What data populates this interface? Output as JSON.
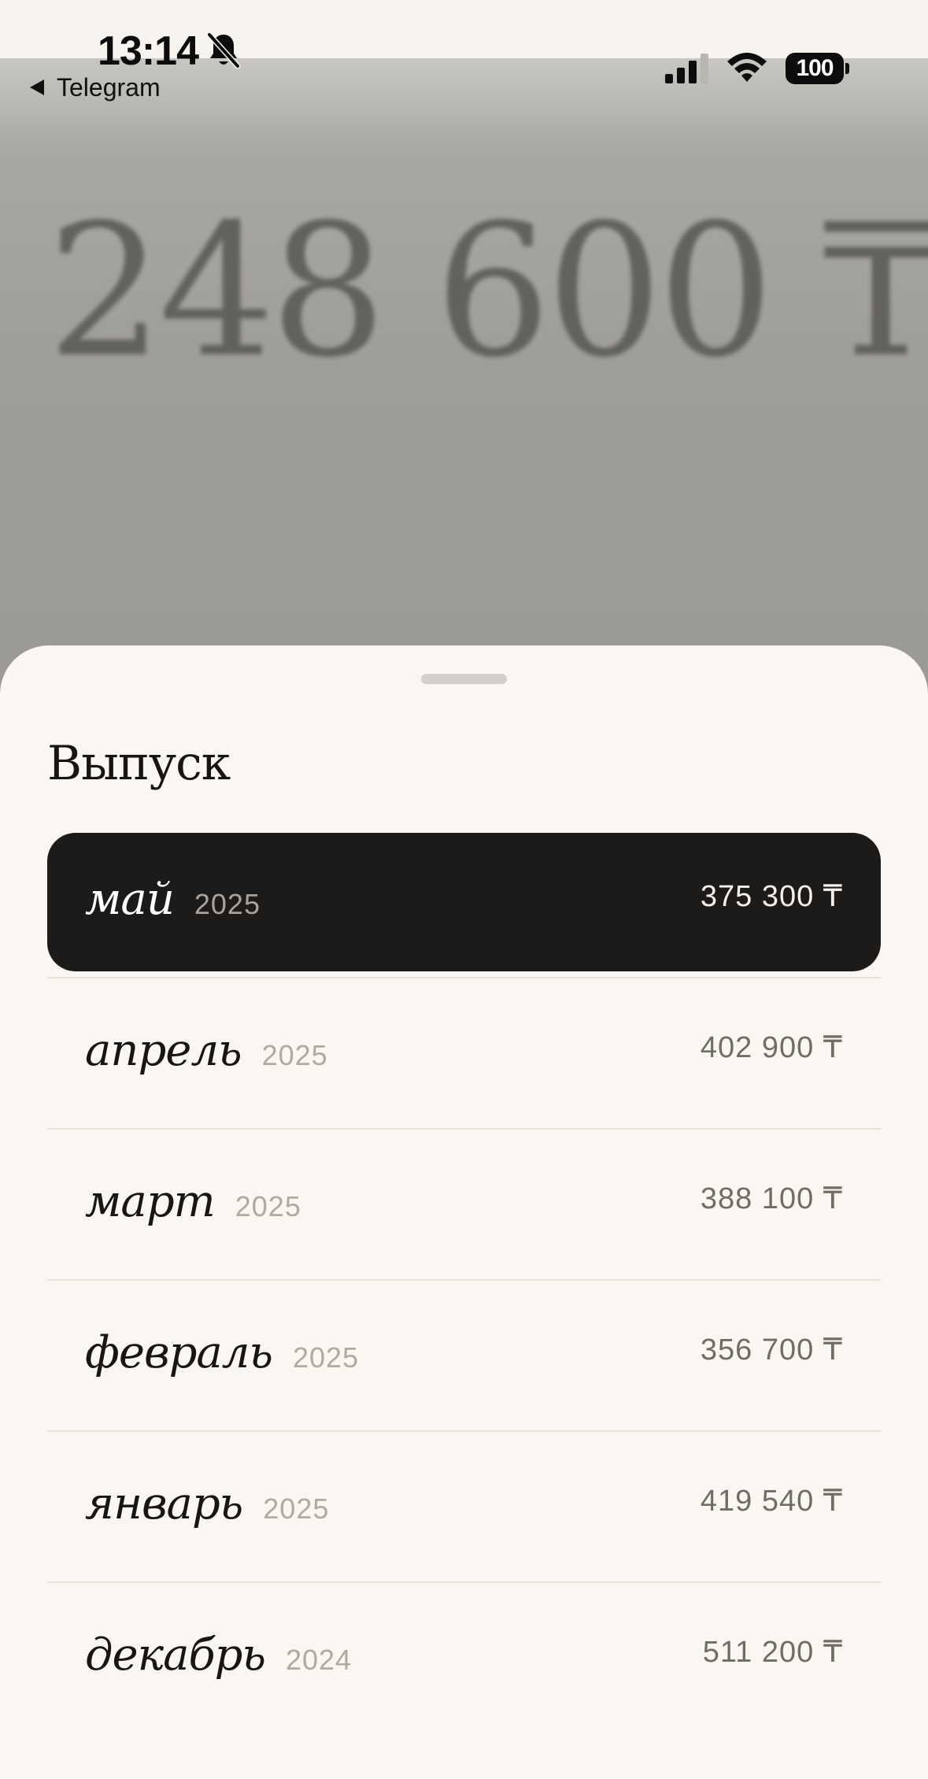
{
  "status_bar": {
    "time": "13:14",
    "back_label": "Telegram",
    "battery": "100",
    "icons": [
      "bell-slash-icon",
      "back-arrow-icon",
      "cellular-signal-icon",
      "wifi-icon",
      "battery-icon"
    ]
  },
  "background": {
    "amount": "248 600 ₸"
  },
  "sheet": {
    "title": "Выпуск",
    "selected_index": 0,
    "items": [
      {
        "month": "май",
        "year": "2025",
        "amount": "375 300 ₸"
      },
      {
        "month": "апрель",
        "year": "2025",
        "amount": "402 900 ₸"
      },
      {
        "month": "март",
        "year": "2025",
        "amount": "388 100 ₸"
      },
      {
        "month": "февраль",
        "year": "2025",
        "amount": "356 700 ₸"
      },
      {
        "month": "январь",
        "year": "2025",
        "amount": "419 540 ₸"
      },
      {
        "month": "декабрь",
        "year": "2024",
        "amount": "511 200 ₸"
      }
    ]
  },
  "colors": {
    "sheet_background": "#faf6f1",
    "selected_row": "#1c1b1a",
    "year_text": "#b0aa9f",
    "amount_text": "#716d66"
  }
}
